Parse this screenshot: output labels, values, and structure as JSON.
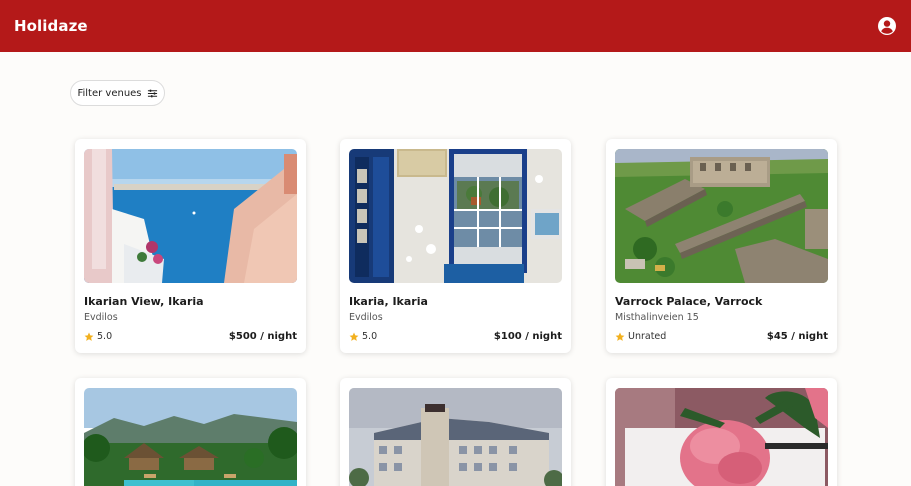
{
  "header": {
    "brand": "Holidaze",
    "account_icon": "user-circle-icon",
    "background_color": "#b41919"
  },
  "toolbar": {
    "filter_label": "Filter venues",
    "filter_icon": "sliders-icon"
  },
  "venues": [
    {
      "title": "Ikarian View, Ikaria",
      "location": "Evdilos",
      "rating": "5.0",
      "price": "$500",
      "per": " / night",
      "image": "santorini-sea-view"
    },
    {
      "title": "Ikaria, Ikaria",
      "location": "Evdilos",
      "rating": "5.0",
      "price": "$100",
      "per": " / night",
      "image": "blue-window-plants"
    },
    {
      "title": "Varrock Palace, Varrock",
      "location": "Misthalinveien 15",
      "rating": "Unrated",
      "price": "$45",
      "per": " / night",
      "image": "castle-aerial"
    },
    {
      "title": "",
      "location": "",
      "rating": "",
      "price": "",
      "per": "",
      "image": "tropical-pool-resort"
    },
    {
      "title": "",
      "location": "",
      "rating": "",
      "price": "",
      "per": "",
      "image": "hotel-building"
    },
    {
      "title": "",
      "location": "",
      "rating": "",
      "price": "",
      "per": "",
      "image": "pink-peony"
    }
  ],
  "colors": {
    "accent": "#b41919",
    "star": "#f2b01e",
    "page_bg": "#fdfcfa"
  }
}
